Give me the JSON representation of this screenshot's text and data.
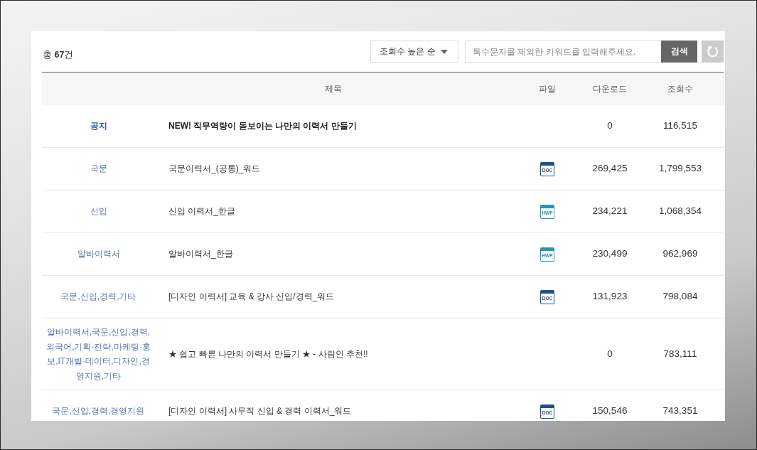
{
  "toolbar": {
    "total": "총 **67**건",
    "sort": {
      "value": "조회수 높은 순"
    },
    "search": {
      "placeholder": "특수문자를 제외한 키워드를 입력해주세요.",
      "button": "검색"
    }
  },
  "table": {
    "columns": [
      "제목",
      "파일",
      "다운로드",
      "조회수"
    ],
    "rows": [
      {
        "kind": "notice",
        "category": "공지",
        "title": "NEW! 직무역량이 돋보이는 나만의 이력서 만들기",
        "downloads": "0",
        "views": "116,515"
      },
      {
        "kind": "post",
        "category": "국문",
        "title": "국문이력서_(공통)_워드",
        "file": {
          "label": "DOC",
          "color": "#1f4f8e"
        },
        "downloads": "269,425",
        "views": "1,799,553"
      },
      {
        "kind": "post",
        "category": "신입",
        "title": "신입 이력서_한글",
        "file": {
          "label": "HWP",
          "color": "#2b94b6"
        },
        "downloads": "234,221",
        "views": "1,068,354"
      },
      {
        "kind": "post",
        "category": "알바이력서",
        "title": "알바이력서_한글",
        "file": {
          "label": "HWP",
          "color": "#2b94b6"
        },
        "downloads": "230,499",
        "views": "962,969"
      },
      {
        "kind": "post",
        "category": "국문,신입,경력,기타",
        "title": "[디자인 이력서] 교육 & 강사 신입/경력_워드",
        "file": {
          "label": "DOC",
          "color": "#1f4f8e"
        },
        "downloads": "131,923",
        "views": "798,084"
      },
      {
        "kind": "post",
        "category": "알바이력서,국문,신입,경력,외국어,기획·전략,마케팅·홍보,IT개발·데이터,디자인,경영지원,기타",
        "title": "★ 쉽고 빠른 나만의 이력서 만들기 ★ - 사람인 추천!!",
        "downloads": "0",
        "views": "783,111"
      },
      {
        "kind": "post",
        "category": "국문,신입,경력,경영지원",
        "title": "[디자인 이력서] 사무직 신입 & 경력 이력서_워드",
        "file": {
          "label": "DOC",
          "color": "#1f4f8e"
        },
        "downloads": "150,546",
        "views": "743,351"
      }
    ]
  }
}
